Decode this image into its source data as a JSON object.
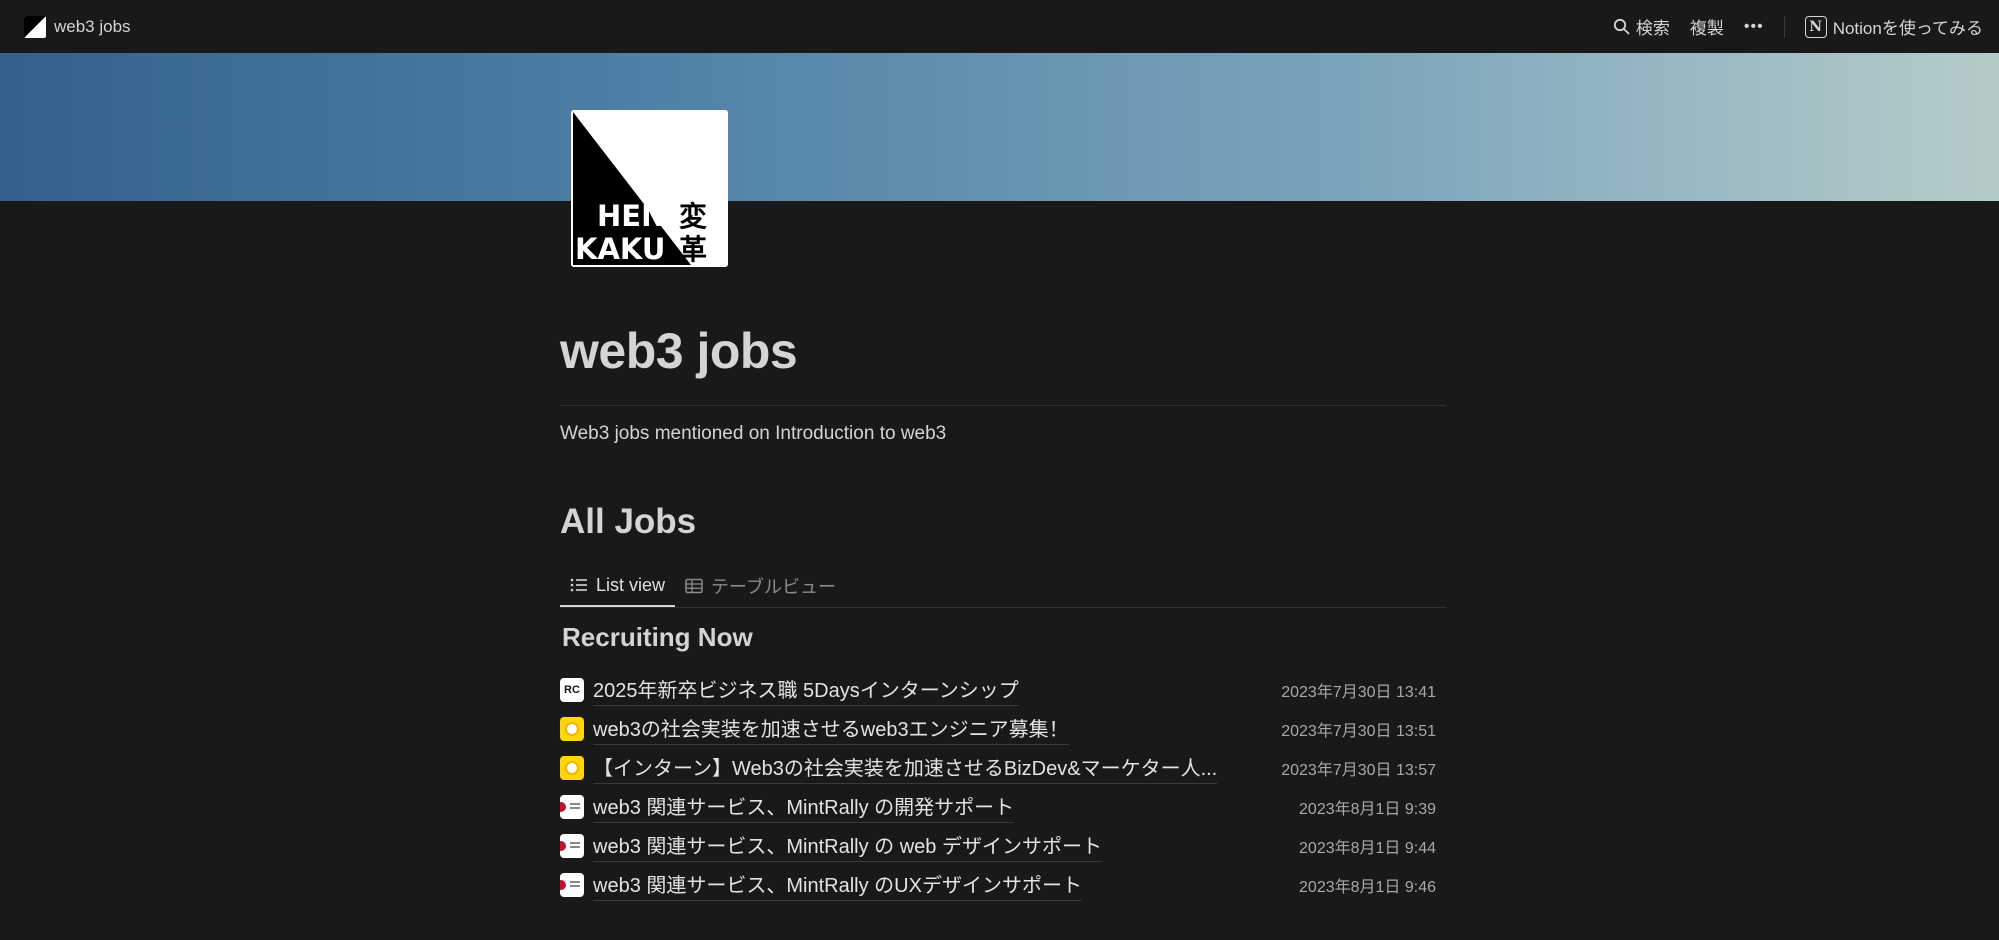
{
  "topbar": {
    "page_name": "web3 jobs",
    "search_label": "検索",
    "duplicate_label": "複製",
    "more_label": "•••",
    "notion_label": "Notionを使ってみる"
  },
  "page": {
    "icon_text_line1": "HEN",
    "icon_text_line2": "KAKU",
    "icon_kanji1": "変",
    "icon_kanji2": "革",
    "title": "web3 jobs",
    "description": "Web3 jobs mentioned on Introduction to web3"
  },
  "database": {
    "heading": "All Jobs",
    "tabs": [
      {
        "label": "List view",
        "icon": "list-icon",
        "active": true
      },
      {
        "label": "テーブルビュー",
        "icon": "table-icon",
        "active": false
      }
    ],
    "group": "Recruiting Now",
    "rows": [
      {
        "icon": "rc-logo",
        "title": "2025年新卒ビジネス職 5Daysインターンシップ",
        "date": "2023年7月30日 13:41"
      },
      {
        "icon": "yellow-logo",
        "title": "web3の社会実装を加速させるweb3エンジニア募集！",
        "date": "2023年7月30日 13:51"
      },
      {
        "icon": "yellow-logo",
        "title": "【インターン】Web3の社会実装を加速させるBizDev&マーケター人...",
        "date": "2023年7月30日 13:57"
      },
      {
        "icon": "japan-logo",
        "title": "web3 関連サービス、MintRally の開発サポート",
        "date": "2023年8月1日 9:39"
      },
      {
        "icon": "japan-logo",
        "title": "web3 関連サービス、MintRally の web デザインサポート",
        "date": "2023年8月1日 9:44"
      },
      {
        "icon": "japan-logo",
        "title": "web3 関連サービス、MintRally のUXデザインサポート",
        "date": "2023年8月1日 9:46"
      }
    ]
  }
}
